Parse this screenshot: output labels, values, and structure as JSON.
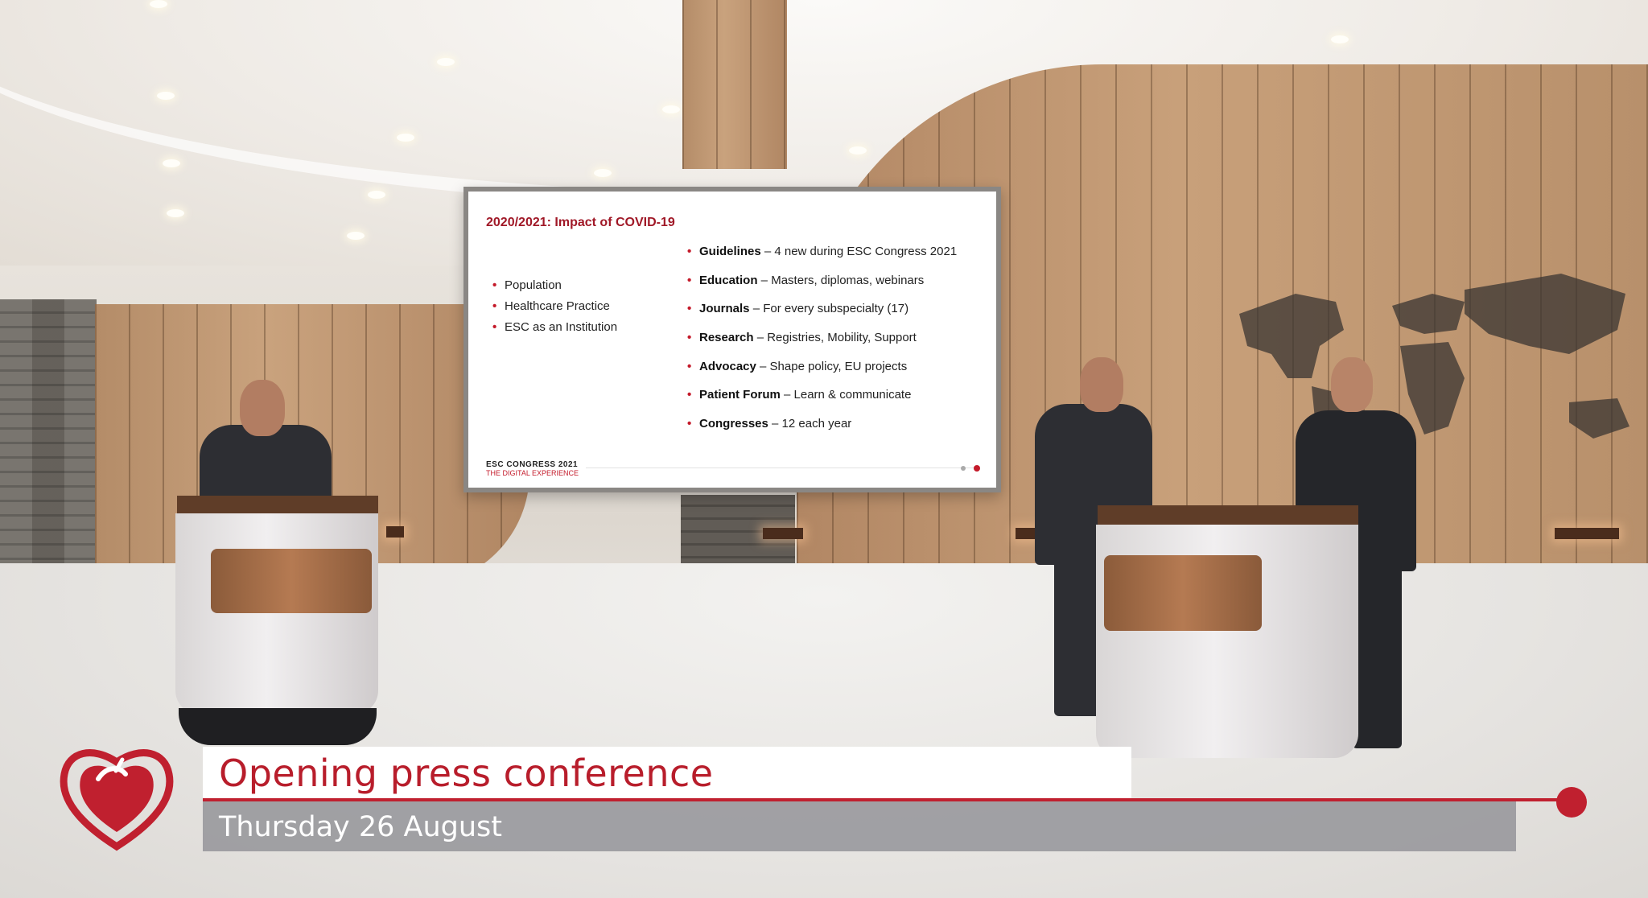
{
  "slide": {
    "title": "2020/2021: Impact of COVID-19",
    "left_bullets": [
      "Population",
      "Healthcare Practice",
      "ESC as an Institution"
    ],
    "right_bullets": [
      {
        "keyword": "Guidelines",
        "text": " – 4 new during ESC Congress 2021"
      },
      {
        "keyword": "Education",
        "text": " – Masters, diplomas, webinars"
      },
      {
        "keyword": "Journals",
        "text": " – For every subspecialty (17)"
      },
      {
        "keyword": "Research",
        "text": " – Registries, Mobility, Support"
      },
      {
        "keyword": "Advocacy",
        "text": " – Shape policy, EU projects"
      },
      {
        "keyword": "Patient Forum",
        "text": " – Learn & communicate"
      },
      {
        "keyword": "Congresses",
        "text": " – 12 each year"
      }
    ],
    "logo_line1": "ESC CONGRESS 2021",
    "logo_line2": "THE DIGITAL EXPERIENCE"
  },
  "lower_third": {
    "title": "Opening press conference",
    "date": "Thursday 26 August"
  },
  "colors": {
    "accent_red": "#c0202f",
    "slide_title_red": "#a01827",
    "date_bar_grey": "#96969b"
  }
}
